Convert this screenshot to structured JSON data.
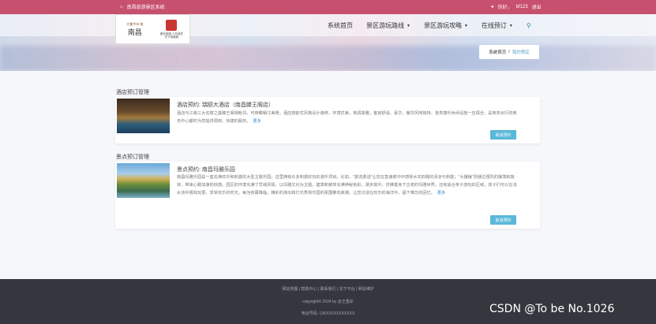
{
  "topbar": {
    "site_name": "南昌旅游景区系统",
    "greeting": "你好，",
    "username": "bf123",
    "logout": "退出"
  },
  "logo": {
    "left_top": "大美中州 城",
    "left_main": "南昌",
    "right_line1": "爱在英雄 人杰地灵",
    "right_line2": "天下英雄城"
  },
  "nav": {
    "items": [
      {
        "label": "系统首页",
        "has_dropdown": false
      },
      {
        "label": "景区游玩路线",
        "has_dropdown": true
      },
      {
        "label": "景区游玩攻略",
        "has_dropdown": true
      },
      {
        "label": "在线预订",
        "has_dropdown": true
      }
    ]
  },
  "breadcrumb": {
    "home": "系统首页",
    "separator": "/",
    "current": "我的预定"
  },
  "hotel_section": {
    "title": "酒店预订管理",
    "card": {
      "title": "酒店预约: 瑞颐大酒店（南昌滕王阁店）",
      "desc": "酒店与江南三大名楼之首滕王阁相毗邻，可俯瞰赣江美景。酒店按欧式风格设计装修，环境优美，格调高雅。客房舒适、豪华，餐饮风味独特，各类康乐休闲设施一应俱全，是商务出行的商务中心都时为您提供周到、快捷的服务。",
      "more": "更多",
      "button": "取消预约"
    }
  },
  "scenic_section": {
    "title": "景点预订管理",
    "card": {
      "title": "景点预约: 南昌玛雅乐园",
      "desc": "南昌玛雅乐园是一座充满欢乐和刺激的大型主题乐园。这里拥有众多刺激好玩的游乐项目。比如，\"激流勇进\"让您在急速俯冲中感受水花四溅的清凉与刺激；\"大摆锤\"则通过强烈的摆荡和旋转，带来心跳加速的快感。园区的环境充满了异域风情，以玛雅文化为主题，建筑和装饰充满神秘色彩。漫步其中，仿佛置身于古老的玛雅世界。还有适合亲子游玩的区域，孩子们可以在浅水池中嬉戏玩耍，享受欢乐的时光。每当夜幕降临，精彩的演出和灯光秀将乐园的氛围推向高潮，让您沉浸在欢乐的海洋中，留下难忘的回忆。",
      "more": "更多",
      "button": "取消预约"
    }
  },
  "footer": {
    "links": "网站地图 | 帮助中心 | 联系我们 | 关于平台 | 网站维护",
    "copyright": "copyright© 2024 by @王重彩",
    "phone": "电话号码:  136XXXXXXXXXXX"
  },
  "watermark": "CSDN @To be No.1026",
  "colors": {
    "topbar": "#c8506f",
    "button": "#5ab8d9",
    "footer": "#34373e",
    "link": "#3b8bd1"
  }
}
